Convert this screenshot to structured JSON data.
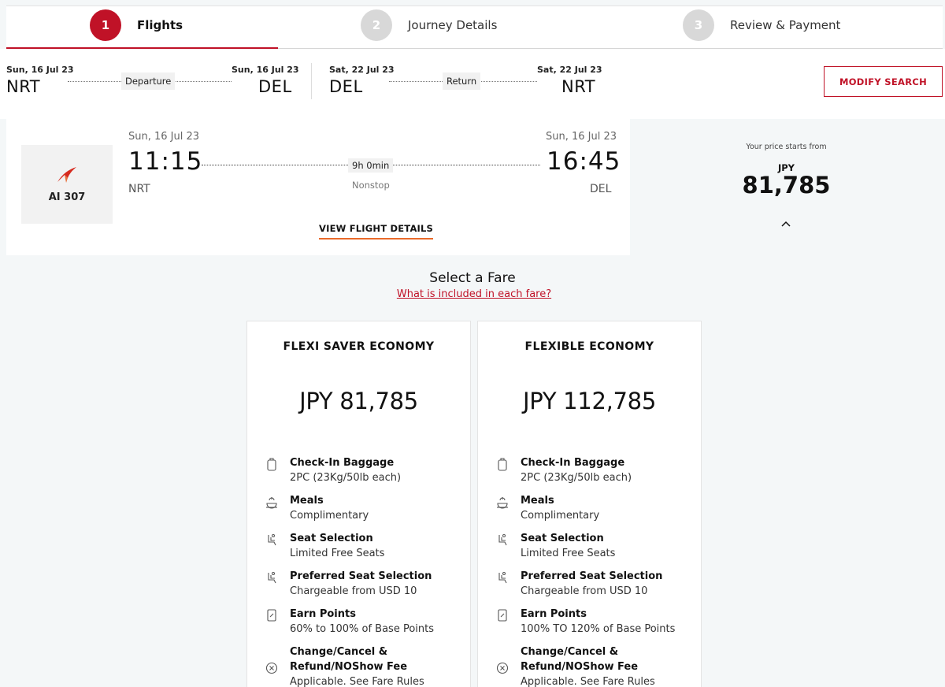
{
  "stepper": {
    "steps": [
      {
        "num": "1",
        "label": "Flights"
      },
      {
        "num": "2",
        "label": "Journey Details"
      },
      {
        "num": "3",
        "label": "Review & Payment"
      }
    ]
  },
  "route": {
    "outbound": {
      "from_date": "Sun, 16 Jul 23",
      "from_code": "NRT",
      "tag": "Departure",
      "to_date": "Sun, 16 Jul 23",
      "to_code": "DEL"
    },
    "inbound": {
      "from_date": "Sat, 22 Jul 23",
      "from_code": "DEL",
      "tag": "Return",
      "to_date": "Sat, 22 Jul 23",
      "to_code": "NRT"
    },
    "modify_label": "MODIFY SEARCH"
  },
  "flight": {
    "number": "AI 307",
    "dep_date": "Sun, 16 Jul 23",
    "dep_time": "11:15",
    "dep_code": "NRT",
    "arr_date": "Sun, 16 Jul 23",
    "arr_time": "16:45",
    "arr_code": "DEL",
    "duration": "9h 0min",
    "stops": "Nonstop",
    "details_label": "VIEW FLIGHT DETAILS",
    "price_starts": "Your price starts from",
    "price_currency": "JPY",
    "price_amount": "81,785"
  },
  "fares": {
    "title": "Select a Fare",
    "link": "What is included in each fare?",
    "cards": [
      {
        "name": "FLEXI SAVER ECONOMY",
        "price": "JPY 81,785",
        "features": [
          {
            "icon": "baggage-icon",
            "title": "Check-In Baggage",
            "value": "2PC (23Kg/50lb each)"
          },
          {
            "icon": "meal-icon",
            "title": "Meals",
            "value": "Complimentary"
          },
          {
            "icon": "seat-icon",
            "title": "Seat Selection",
            "value": "Limited Free Seats"
          },
          {
            "icon": "seat-icon",
            "title": "Preferred Seat Selection",
            "value": "Chargeable from USD 10"
          },
          {
            "icon": "points-icon",
            "title": "Earn Points",
            "value": "60% to 100% of Base Points"
          },
          {
            "icon": "cancel-icon",
            "title_l1": "Change/Cancel &",
            "title_l2": "Refund/NOShow Fee",
            "value": "Applicable. See Fare Rules"
          }
        ]
      },
      {
        "name": "FLEXIBLE ECONOMY",
        "price": "JPY 112,785",
        "features": [
          {
            "icon": "baggage-icon",
            "title": "Check-In Baggage",
            "value": "2PC (23Kg/50lb each)"
          },
          {
            "icon": "meal-icon",
            "title": "Meals",
            "value": "Complimentary"
          },
          {
            "icon": "seat-icon",
            "title": "Seat Selection",
            "value": "Limited Free Seats"
          },
          {
            "icon": "seat-icon",
            "title": "Preferred Seat Selection",
            "value": "Chargeable from USD 10"
          },
          {
            "icon": "points-icon",
            "title": "Earn Points",
            "value": "100% TO 120% of Base Points"
          },
          {
            "icon": "cancel-icon",
            "title_l1": "Change/Cancel &",
            "title_l2": "Refund/NOShow Fee",
            "value": "Applicable. See Fare Rules"
          }
        ]
      }
    ]
  },
  "colors": {
    "brand_red": "#c01227",
    "accent_orange": "#ea6a2a",
    "muted": "#d8d8d8"
  }
}
